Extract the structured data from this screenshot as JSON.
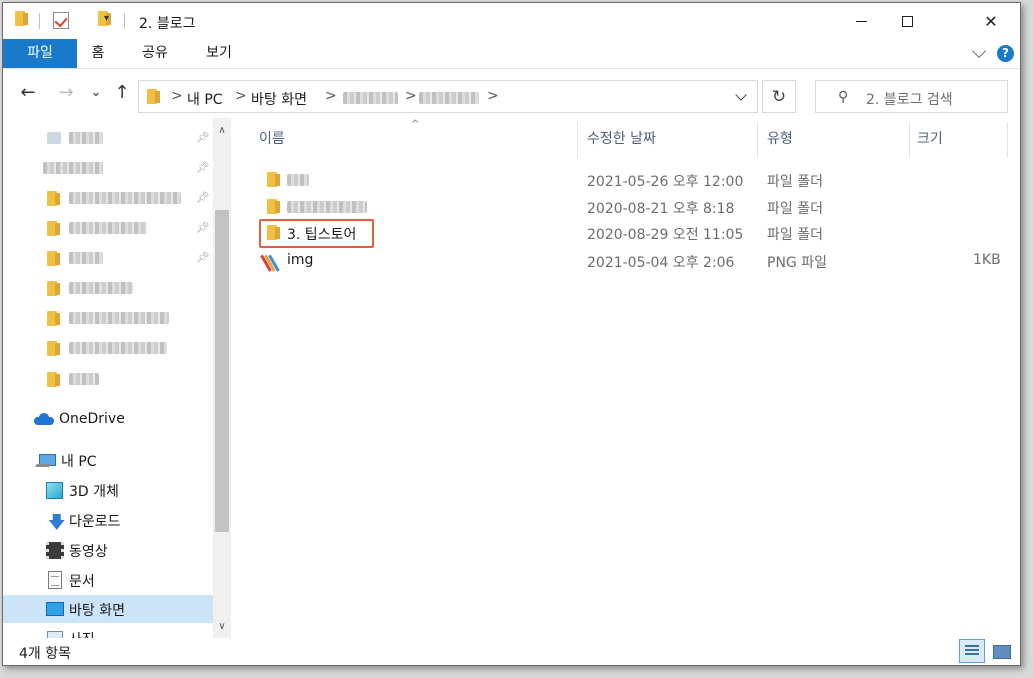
{
  "window": {
    "title": "2. 블로그"
  },
  "ribbon": {
    "tabs": [
      "파일",
      "홈",
      "공유",
      "보기"
    ],
    "help": "?"
  },
  "nav": {
    "back": "←",
    "forward": "→",
    "recent": "⌄",
    "up": "↑"
  },
  "address": {
    "crumbs": [
      "내 PC",
      "바탕 화면"
    ],
    "separator": ">"
  },
  "search": {
    "placeholder": "2. 블로그 검색"
  },
  "sidebar": {
    "onedrive": "OneDrive",
    "this_pc": "내 PC",
    "pc_items": [
      "3D 개체",
      "다운로드",
      "동영상",
      "문서",
      "바탕 화면",
      "사진"
    ]
  },
  "columns": {
    "name": "이름",
    "date": "수정한 날짜",
    "type": "유형",
    "size": "크기"
  },
  "files": [
    {
      "name": "",
      "date": "2021-05-26 오후 12:00",
      "type": "파일 폴더",
      "size": ""
    },
    {
      "name": "",
      "date": "2020-08-21 오후 8:18",
      "type": "파일 폴더",
      "size": ""
    },
    {
      "name": "3. 팁스토어",
      "date": "2020-08-29 오전 11:05",
      "type": "파일 폴더",
      "size": ""
    },
    {
      "name": "img",
      "date": "2021-05-04 오후 2:06",
      "type": "PNG 파일",
      "size": "1KB"
    }
  ],
  "status": {
    "item_count": "4개 항목"
  },
  "colors": {
    "accent": "#1979ca",
    "highlight": "#e0603a",
    "folder": "#f0c043",
    "selected": "#cce4f7"
  }
}
